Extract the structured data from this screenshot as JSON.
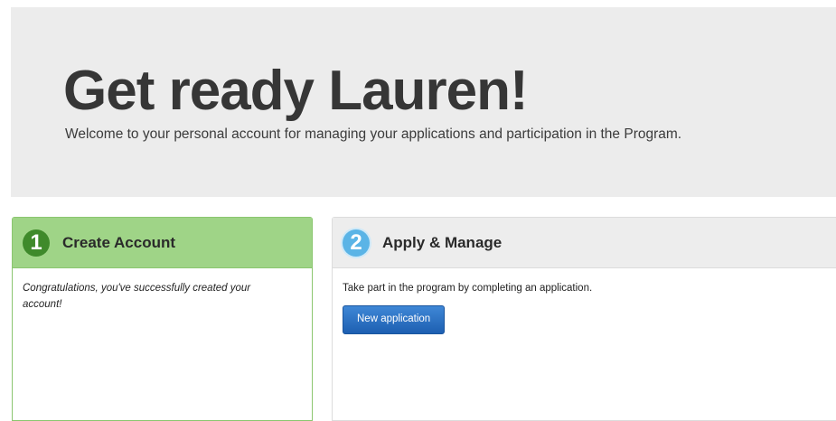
{
  "hero": {
    "title": "Get ready Lauren!",
    "subtitle": "Welcome to your personal account for managing your applications and participation in the Program."
  },
  "steps": [
    {
      "number": "1",
      "title": "Create Account",
      "body": "Congratulations, you've successfully created your account!",
      "badge_color": "#3f8a2b",
      "header_color": "#9fd487"
    },
    {
      "number": "2",
      "title": "Apply & Manage",
      "body": "Take part in the program by completing an application.",
      "button_label": "New application",
      "badge_color": "#5bb4e6",
      "header_color": "#ededed"
    }
  ],
  "colors": {
    "hero_background": "#ececec",
    "button_blue": "#2a6fc2"
  }
}
